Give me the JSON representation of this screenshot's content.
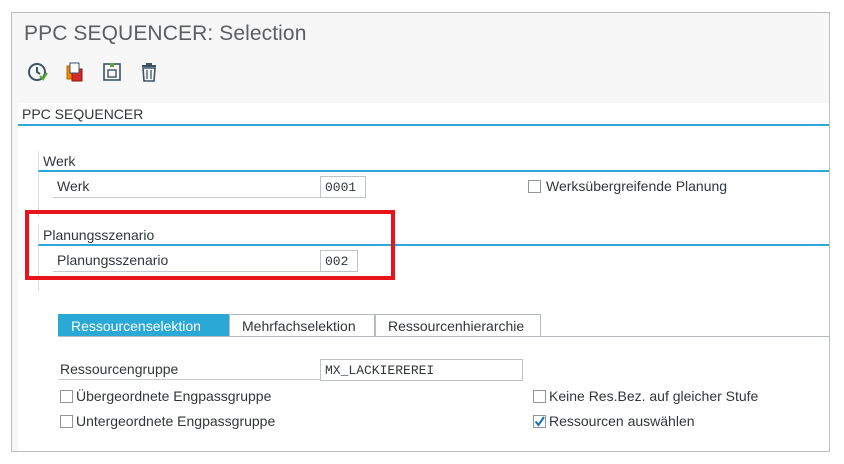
{
  "window": {
    "title": "PPC SEQUENCER: Selection"
  },
  "toolbar": {
    "buttons": [
      {
        "icon": "execute-clock-icon"
      },
      {
        "icon": "copy-variant-icon"
      },
      {
        "icon": "save-variant-icon"
      },
      {
        "icon": "delete-trash-icon"
      }
    ]
  },
  "pane": {
    "title": "PPC SEQUENCER"
  },
  "werk_group": {
    "title": "Werk",
    "field_label": "Werk",
    "field_value": "0001",
    "checkbox_label": "Werksübergreifende Planung",
    "checkbox_checked": false
  },
  "scenario_group": {
    "title": "Planungsszenario",
    "field_label": "Planungsszenario",
    "field_value": "002"
  },
  "tabs": [
    {
      "label": "Ressourcenselektion",
      "active": true
    },
    {
      "label": "Mehrfachselektion",
      "active": false
    },
    {
      "label": "Ressourcenhierarchie",
      "active": false
    }
  ],
  "resource": {
    "group_label": "Ressourcengruppe",
    "group_value": "MX_LACKIEREREI",
    "checkboxes": [
      {
        "label": "Übergeordnete Engpassgruppe",
        "checked": false
      },
      {
        "label": "Untergeordnete Engpassgruppe",
        "checked": false
      },
      {
        "label": "Keine Res.Bez. auf gleicher Stufe",
        "checked": false
      },
      {
        "label": "Ressourcen auswählen",
        "checked": true
      }
    ]
  },
  "colors": {
    "accent": "#2aa8d6",
    "highlight": "#e8141b"
  }
}
